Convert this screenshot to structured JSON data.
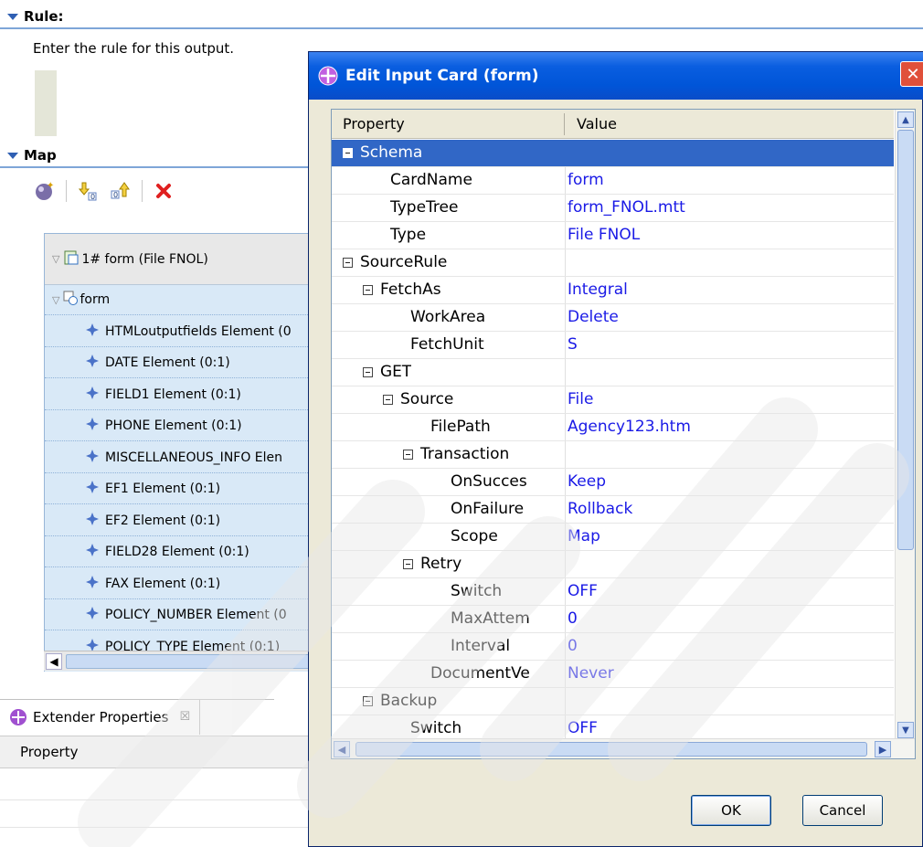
{
  "rule_section": {
    "title": "Rule:",
    "instruction": "Enter the rule for this output."
  },
  "map_section": {
    "title": "Map",
    "toolbar_icons": [
      "build-map-icon",
      "move-down-icon",
      "move-up-icon",
      "delete-icon"
    ],
    "tree_header": "1# form (File FNOL)",
    "tree_items": [
      "form",
      "HTMLoutputfields Element (0",
      "DATE Element (0:1)",
      "FIELD1 Element (0:1)",
      "PHONE Element (0:1)",
      "MISCELLANEOUS_INFO Elen",
      "EF1 Element (0:1)",
      "EF2 Element (0:1)",
      "FIELD28 Element (0:1)",
      "FAX Element (0:1)",
      "POLICY_NUMBER Element (0",
      "POLICY_TYPE Element (0:1)"
    ]
  },
  "extender": {
    "tab_label": "Extender Properties",
    "tab_close": "☒",
    "column_header": "Property"
  },
  "dialog": {
    "title": "Edit Input Card (form)",
    "close_label": "✕",
    "col_property": "Property",
    "col_value": "Value",
    "rows": [
      {
        "name": "Schema",
        "value": "",
        "expander": true,
        "selected": true
      },
      {
        "name": "CardName",
        "value": "form"
      },
      {
        "name": "TypeTree",
        "value": "form_FNOL.mtt"
      },
      {
        "name": "Type",
        "value": "File FNOL"
      },
      {
        "name": "SourceRule",
        "value": "",
        "expander": true
      },
      {
        "name": "FetchAs",
        "value": "Integral",
        "expander": true
      },
      {
        "name": "WorkArea",
        "value": "Delete"
      },
      {
        "name": "FetchUnit",
        "value": "S"
      },
      {
        "name": "GET",
        "value": "",
        "expander": true
      },
      {
        "name": "Source",
        "value": "File",
        "expander": true
      },
      {
        "name": "FilePath",
        "value": "Agency123.htm"
      },
      {
        "name": "Transaction",
        "value": "",
        "expander": true
      },
      {
        "name": "OnSucces",
        "value": "Keep"
      },
      {
        "name": "OnFailure",
        "value": "Rollback"
      },
      {
        "name": "Scope",
        "value": "Map"
      },
      {
        "name": "Retry",
        "value": "",
        "expander": true
      },
      {
        "name": "Switch",
        "value": "OFF"
      },
      {
        "name": "MaxAttem",
        "value": "0"
      },
      {
        "name": "Interval",
        "value": "0"
      },
      {
        "name": "DocumentVe",
        "value": "Never"
      },
      {
        "name": "Backup",
        "value": "",
        "expander": true
      },
      {
        "name": "Switch",
        "value": "OFF"
      }
    ],
    "ok_label": "OK",
    "cancel_label": "Cancel"
  },
  "colors": {
    "title_bar": "#0055d8",
    "selection": "#3167c6",
    "value_text": "#1a1ae6",
    "tree_bg": "#d9e9f7"
  }
}
